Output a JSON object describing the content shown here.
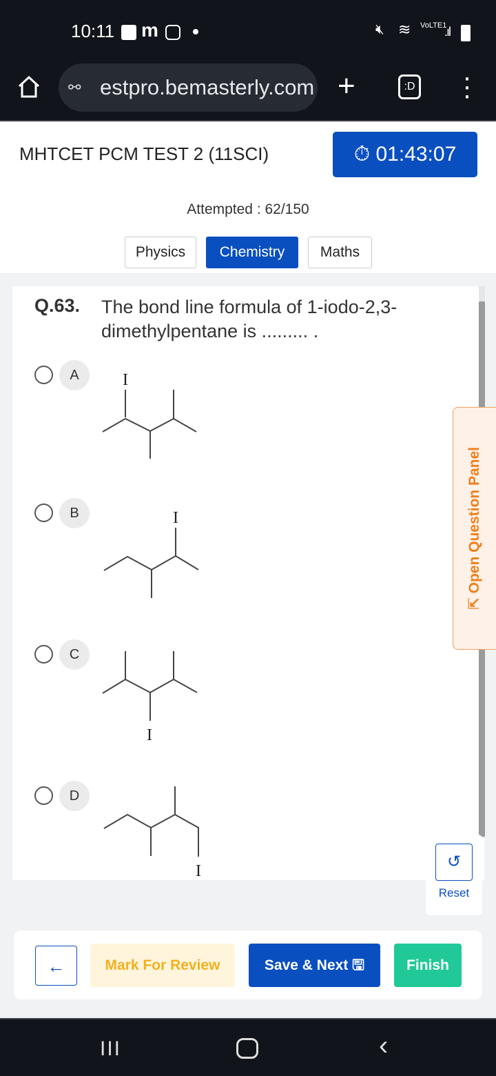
{
  "status_bar": {
    "time": "10:11",
    "network": "VoLTE1"
  },
  "browser": {
    "url": "estpro.bemasterly.com",
    "tab_switcher_label": ":D"
  },
  "header": {
    "title": "MHTCET PCM TEST 2 (11SCI)",
    "timer": "01:43:07"
  },
  "attempted": "Attempted : 62/150",
  "subjects": [
    {
      "label": "Physics",
      "active": false
    },
    {
      "label": "Chemistry",
      "active": true
    },
    {
      "label": "Maths",
      "active": false
    }
  ],
  "question": {
    "number": "Q.63.",
    "text": "The bond line formula of 1-iodo-2,3-dimethylpentane is ......... .",
    "options": [
      {
        "label": "A",
        "atom": "I"
      },
      {
        "label": "B",
        "atom": "I"
      },
      {
        "label": "C",
        "atom": "I"
      },
      {
        "label": "D",
        "atom": "I"
      }
    ]
  },
  "side_panel": {
    "label": "Open Question Panel"
  },
  "reset": {
    "label": "Reset"
  },
  "footer": {
    "mark_review": "Mark For Review",
    "save_next": "Save & Next",
    "finish": "Finish"
  },
  "colors": {
    "primary": "#0a4fbf",
    "finish": "#20c997",
    "review_bg": "#fff5dc",
    "review_text": "#f2b01e",
    "panel": "#ef7f1a"
  }
}
